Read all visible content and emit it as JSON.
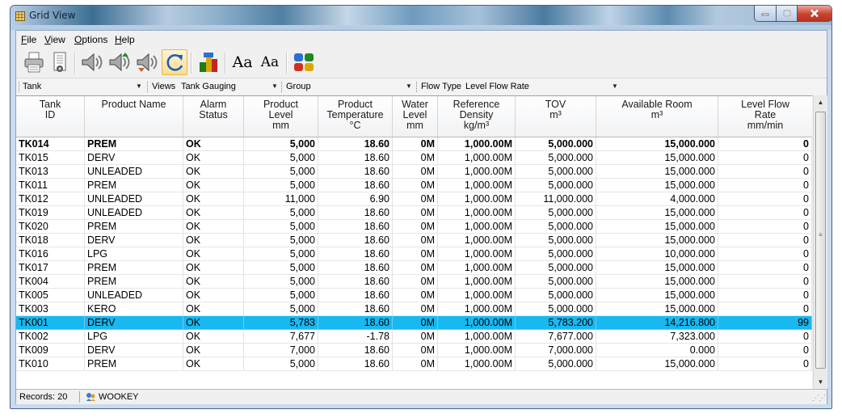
{
  "window": {
    "title": "Grid View"
  },
  "menu": {
    "file": "File",
    "view": "View",
    "options": "Options",
    "help": "Help"
  },
  "toolbar": {
    "buttons": [
      {
        "icon": "printer-icon"
      },
      {
        "icon": "print-preview-icon"
      },
      {
        "icon": "speaker-icon"
      },
      {
        "icon": "speaker-up-icon"
      },
      {
        "icon": "speaker-down-icon"
      },
      {
        "icon": "refresh-icon",
        "active": true
      },
      {
        "icon": "export-excel-icon"
      },
      {
        "icon": "font-increase-icon",
        "label": "Aa"
      },
      {
        "icon": "font-decrease-icon",
        "label": "Aa"
      },
      {
        "icon": "tank-color-icon"
      }
    ]
  },
  "filters": {
    "tank": "Tank",
    "views_label": "Views",
    "views_value": "Tank Gauging",
    "group": "Group",
    "flow_type_label": "Flow Type",
    "flow_type_value": "Level Flow Rate"
  },
  "grid": {
    "columns": [
      "Tank\nID",
      "Product Name",
      "Alarm\nStatus",
      "Product\nLevel\nmm",
      "Product\nTemperature\n°C",
      "Water\nLevel\nmm",
      "Reference\nDensity\nkg/m³",
      "TOV\nm³",
      "Available Room\nm³",
      "Level Flow\nRate\nmm/min"
    ],
    "rows": [
      [
        "TK014",
        "PREM",
        "OK",
        "5,000",
        "18.60",
        "0M",
        "1,000.00M",
        "5,000.000",
        "15,000.000",
        "0"
      ],
      [
        "TK015",
        "DERV",
        "OK",
        "5,000",
        "18.60",
        "0M",
        "1,000.00M",
        "5,000.000",
        "15,000.000",
        "0"
      ],
      [
        "TK013",
        "UNLEADED",
        "OK",
        "5,000",
        "18.60",
        "0M",
        "1,000.00M",
        "5,000.000",
        "15,000.000",
        "0"
      ],
      [
        "TK011",
        "PREM",
        "OK",
        "5,000",
        "18.60",
        "0M",
        "1,000.00M",
        "5,000.000",
        "15,000.000",
        "0"
      ],
      [
        "TK012",
        "UNLEADED",
        "OK",
        "11,000",
        "6.90",
        "0M",
        "1,000.00M",
        "11,000.000",
        "4,000.000",
        "0"
      ],
      [
        "TK019",
        "UNLEADED",
        "OK",
        "5,000",
        "18.60",
        "0M",
        "1,000.00M",
        "5,000.000",
        "15,000.000",
        "0"
      ],
      [
        "TK020",
        "PREM",
        "OK",
        "5,000",
        "18.60",
        "0M",
        "1,000.00M",
        "5,000.000",
        "15,000.000",
        "0"
      ],
      [
        "TK018",
        "DERV",
        "OK",
        "5,000",
        "18.60",
        "0M",
        "1,000.00M",
        "5,000.000",
        "15,000.000",
        "0"
      ],
      [
        "TK016",
        "LPG",
        "OK",
        "5,000",
        "18.60",
        "0M",
        "1,000.00M",
        "5,000.000",
        "10,000.000",
        "0"
      ],
      [
        "TK017",
        "PREM",
        "OK",
        "5,000",
        "18.60",
        "0M",
        "1,000.00M",
        "5,000.000",
        "15,000.000",
        "0"
      ],
      [
        "TK004",
        "PREM",
        "OK",
        "5,000",
        "18.60",
        "0M",
        "1,000.00M",
        "5,000.000",
        "15,000.000",
        "0"
      ],
      [
        "TK005",
        "UNLEADED",
        "OK",
        "5,000",
        "18.60",
        "0M",
        "1,000.00M",
        "5,000.000",
        "15,000.000",
        "0"
      ],
      [
        "TK003",
        "KERO",
        "OK",
        "5,000",
        "18.60",
        "0M",
        "1,000.00M",
        "5,000.000",
        "15,000.000",
        "0"
      ],
      [
        "TK001",
        "DERV",
        "OK",
        "5,783",
        "18.60",
        "0M",
        "1,000.00M",
        "5,783.200",
        "14,216.800",
        "99"
      ],
      [
        "TK002",
        "LPG",
        "OK",
        "7,677",
        "-1.78",
        "0M",
        "1,000.00M",
        "7,677.000",
        "7,323.000",
        "0"
      ],
      [
        "TK009",
        "DERV",
        "OK",
        "7,000",
        "18.60",
        "0M",
        "1,000.00M",
        "7,000.000",
        "0.000",
        "0"
      ],
      [
        "TK010",
        "PREM",
        "OK",
        "5,000",
        "18.60",
        "0M",
        "1,000.00M",
        "5,000.000",
        "15,000.000",
        "0"
      ]
    ],
    "bold_row": 0,
    "selected_row": 13,
    "selection_color": "#18b8f0"
  },
  "status": {
    "records": "Records: 20",
    "user": "WOOKEY"
  }
}
